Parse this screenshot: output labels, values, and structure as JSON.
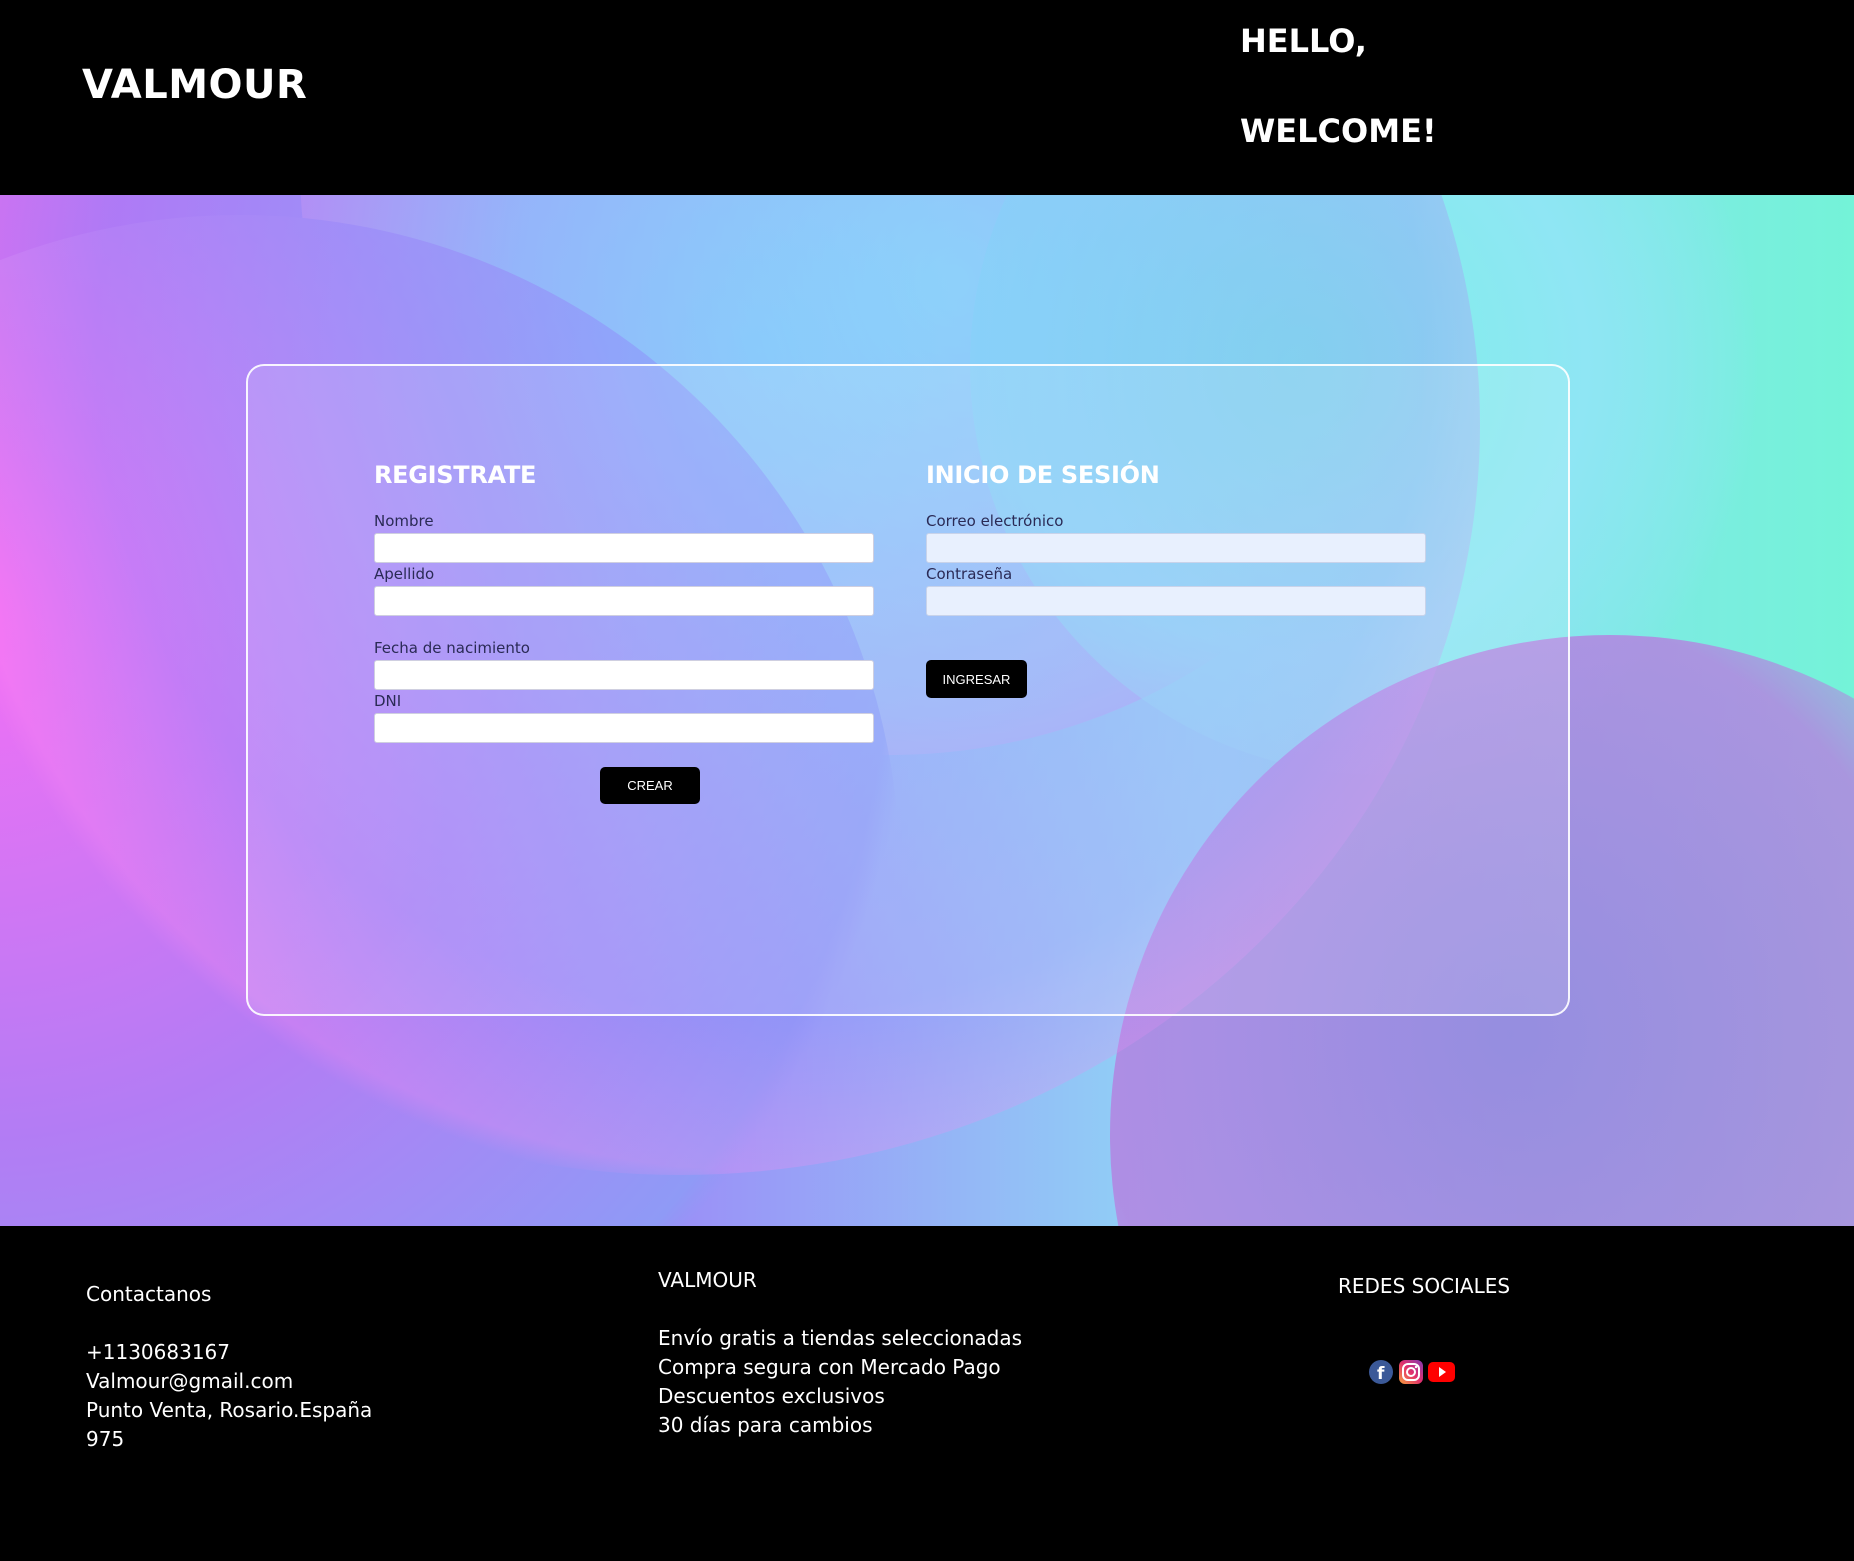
{
  "header": {
    "brand": "VALMOUR",
    "greeting_line1": "HELLO,",
    "greeting_line2": "WELCOME!"
  },
  "register": {
    "title": "REGISTRATE",
    "fields": {
      "nombre": {
        "label": "Nombre",
        "value": ""
      },
      "apellido": {
        "label": "Apellido",
        "value": ""
      },
      "fecha": {
        "label": "Fecha de nacimiento",
        "value": ""
      },
      "dni": {
        "label": "DNI",
        "value": ""
      }
    },
    "button": "CREAR"
  },
  "login": {
    "title": "INICIO DE SESIÓN",
    "fields": {
      "email": {
        "label": "Correo electrónico",
        "value": ""
      },
      "password": {
        "label": "Contraseña",
        "value": ""
      }
    },
    "button": "INGRESAR"
  },
  "footer": {
    "contact": {
      "title": "Contactanos",
      "phone": "+1130683167",
      "email": "Valmour@gmail.com",
      "address_line1": "Punto Venta, Rosario.España",
      "address_line2": "975"
    },
    "brand": {
      "title": "VALMOUR",
      "items": [
        "Envío gratis a tiendas seleccionadas",
        "Compra segura con Mercado Pago",
        "Descuentos exclusivos",
        "30 días para cambios"
      ]
    },
    "social": {
      "title": "REDES SOCIALES",
      "icons": [
        "facebook-icon",
        "instagram-icon",
        "youtube-icon"
      ]
    }
  },
  "colors": {
    "header_bg": "#000000",
    "button_bg": "#000000",
    "facebook": "#3b5998",
    "youtube": "#ff0000"
  }
}
